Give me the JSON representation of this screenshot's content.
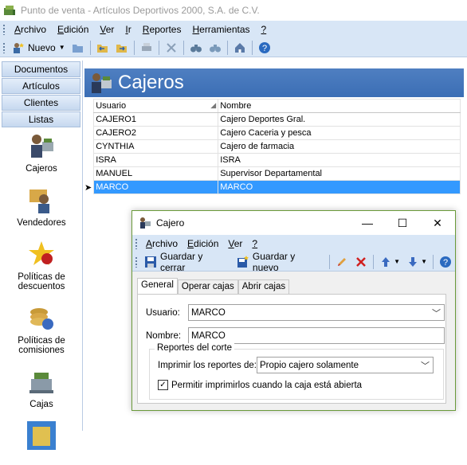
{
  "window": {
    "title": "Punto de venta - Artículos Deportivos 2000, S.A. de C.V."
  },
  "menu": [
    {
      "key": "A",
      "rest": "rchivo"
    },
    {
      "key": "E",
      "rest": "dición"
    },
    {
      "key": "V",
      "rest": "er"
    },
    {
      "key": "I",
      "rest": "r"
    },
    {
      "key": "R",
      "rest": "eportes"
    },
    {
      "key": "H",
      "rest": "erramientas"
    },
    {
      "key": "?",
      "rest": ""
    }
  ],
  "toolbar": {
    "new_label": "Nuevo"
  },
  "nav": {
    "tabs": [
      "Documentos",
      "Artículos",
      "Clientes",
      "Listas"
    ],
    "items": [
      "Cajeros",
      "Vendedores",
      "Políticas de descuentos",
      "Políticas de comisiones",
      "Cajas"
    ]
  },
  "page": {
    "title": "Cajeros"
  },
  "grid": {
    "columns": [
      "Usuario",
      "Nombre"
    ],
    "rows": [
      [
        "CAJERO1",
        "Cajero Deportes Gral."
      ],
      [
        "CAJERO2",
        "Cajero Caceria y pesca"
      ],
      [
        "CYNTHIA",
        "Cajero de farmacia"
      ],
      [
        "ISRA",
        "ISRA"
      ],
      [
        "MANUEL",
        "Supervisor Departamental"
      ],
      [
        "MARCO",
        "MARCO"
      ]
    ],
    "selected_row": 5
  },
  "dialog": {
    "title": "Cajero",
    "menu": [
      {
        "key": "A",
        "rest": "rchivo"
      },
      {
        "key": "E",
        "rest": "dición"
      },
      {
        "key": "V",
        "rest": "er"
      },
      {
        "key": "?",
        "rest": ""
      }
    ],
    "save_close": "Guardar y cerrar",
    "save_new": "Guardar y nuevo",
    "tabs": [
      "General",
      "Operar cajas",
      "Abrir cajas"
    ],
    "usuario_label": "Usuario:",
    "usuario_value": "MARCO",
    "nombre_label": "Nombre:",
    "nombre_value": "MARCO",
    "group_title": "Reportes del corte",
    "imprimir_label": "Imprimir los reportes de:",
    "imprimir_value": "Propio cajero solamente",
    "permitir_label": "Permitir imprimirlos cuando la caja está abierta",
    "permitir_checked": true
  },
  "colors": {
    "accent": "#3b6eb5",
    "selection": "#3399ff",
    "toolbar_bg": "#d8e6f6"
  }
}
